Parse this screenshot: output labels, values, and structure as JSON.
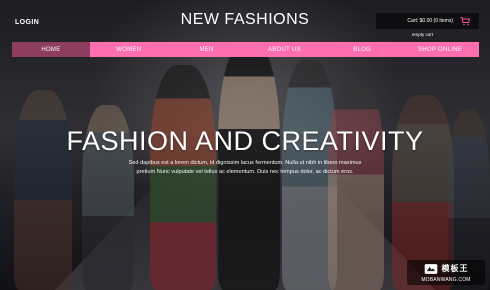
{
  "header": {
    "login_label": "LOGIN",
    "brand": "NEW FASHIONS",
    "cart_summary": "Cart: $0.00 (0 items)",
    "empty_cart_label": "empty cart",
    "cart_icon": "shopping-bag-icon"
  },
  "nav": {
    "items": [
      {
        "label": "HOME",
        "active": true
      },
      {
        "label": "WOMEN",
        "active": false
      },
      {
        "label": "MEN",
        "active": false
      },
      {
        "label": "ABOUT US",
        "active": false
      },
      {
        "label": "BLOG",
        "active": false
      },
      {
        "label": "SHOP ONLINE",
        "active": false
      }
    ],
    "accent_color": "#ff6fb0"
  },
  "hero": {
    "title": "FASHION AND CREATIVITY",
    "text": "Sed dapibus est a lorem dictum, id dignissim lacus fermentum. Nulla ut nibh in libero maximus pretium Nunc vulputate vel tellus ac elementum. Duis nec tempus dolor, ac dictum eros."
  },
  "watermark": {
    "cn": "模板王",
    "en": "MOBANWANG.COM"
  }
}
